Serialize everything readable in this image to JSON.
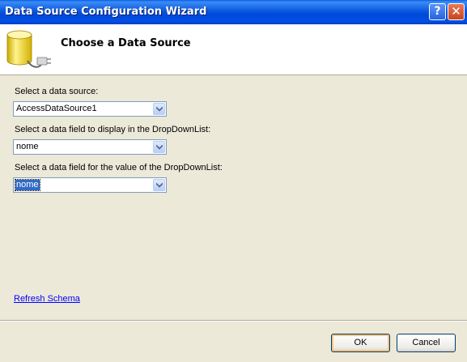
{
  "window": {
    "title": "Data Source Configuration Wizard",
    "help_glyph": "?",
    "close_glyph": "✕"
  },
  "header": {
    "title": "Choose a Data Source",
    "icon": "database-icon"
  },
  "form": {
    "data_source": {
      "label": "Select a data source:",
      "value": "AccessDataSource1"
    },
    "display_field": {
      "label": "Select a data field to display in the DropDownList:",
      "value": "nome"
    },
    "value_field": {
      "label": "Select a data field for the value of the DropDownList:",
      "value": "nome"
    }
  },
  "links": {
    "refresh_schema": "Refresh Schema"
  },
  "buttons": {
    "ok": "OK",
    "cancel": "Cancel"
  },
  "colors": {
    "titlebar": "#0a58e0",
    "dialog_bg": "#ece9d8",
    "link": "#0000ff",
    "selection": "#316ac5"
  }
}
